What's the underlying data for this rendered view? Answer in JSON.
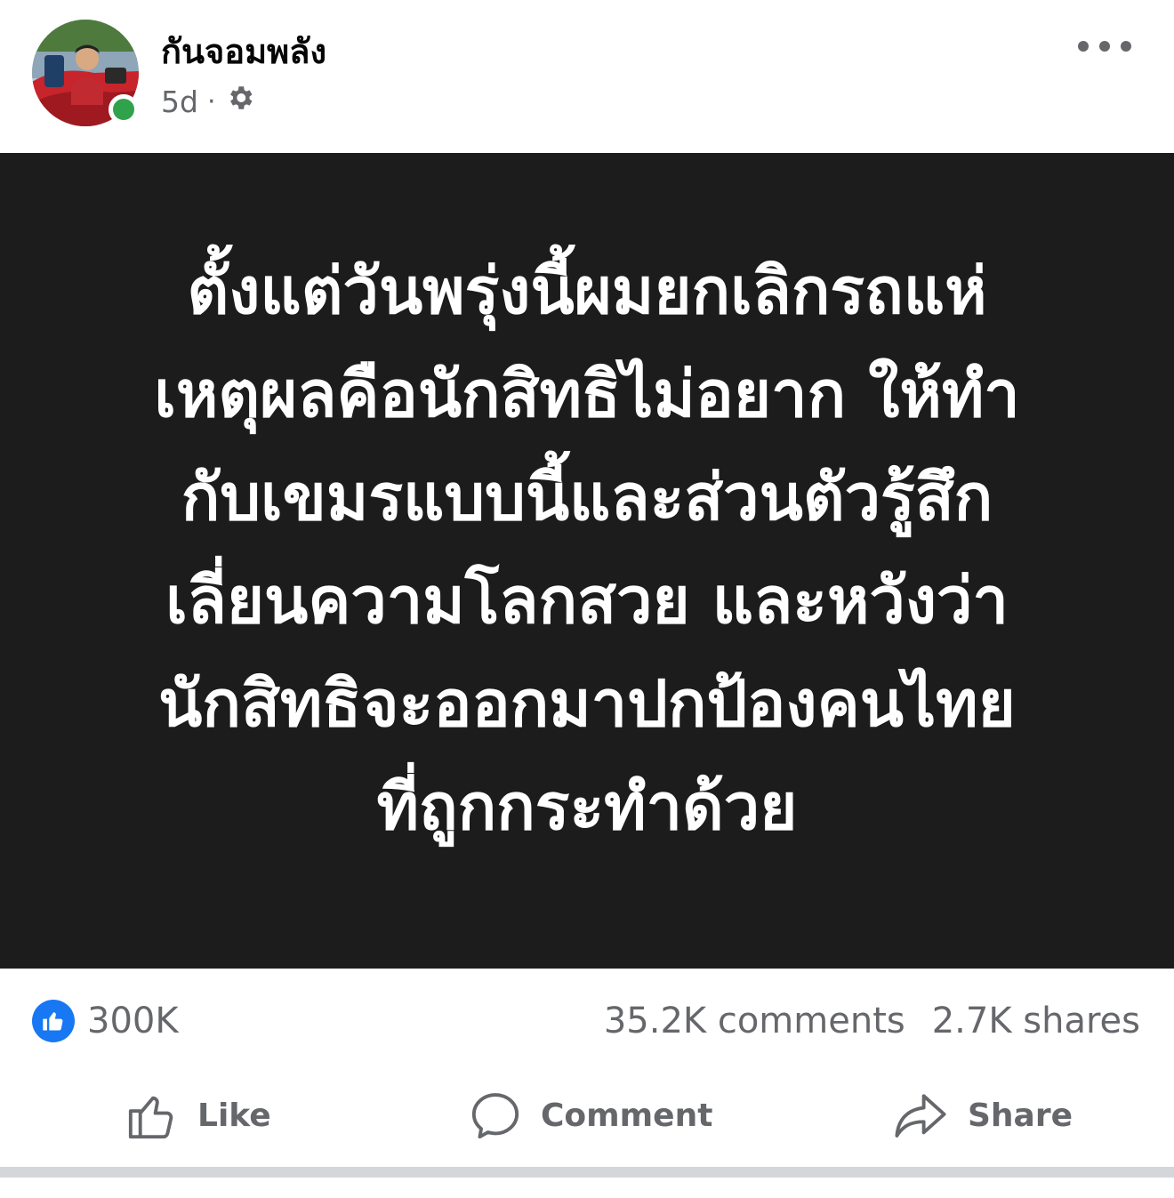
{
  "post": {
    "author": "กันจอมพลัง",
    "time": "5d",
    "separator": "·",
    "privacy_icon": "gear-icon",
    "more_icon": "more-horizontal-icon",
    "text": "ตั้งแต่วันพรุ่งนี้ผมยกเลิกรถแห่\nเหตุผลคือนักสิทธิไม่อยาก ให้ทำ\nกับเขมรแบบนี้และส่วนตัวรู้สึก\nเลี่ยนความโลกสวย และหวังว่า\nนักสิทธิจะออกมาปกป้องคนไทย\nที่ถูกกระทำด้วย",
    "background_color": "#1c1c1c"
  },
  "stats": {
    "reaction_icon": "thumbs-up-icon",
    "reactions": "300K",
    "comments": "35.2K comments",
    "shares": "2.7K shares"
  },
  "actions": {
    "like_label": "Like",
    "comment_label": "Comment",
    "share_label": "Share"
  },
  "colors": {
    "accent": "#1877f2",
    "secondary_text": "#65676b",
    "online": "#31a24c"
  }
}
